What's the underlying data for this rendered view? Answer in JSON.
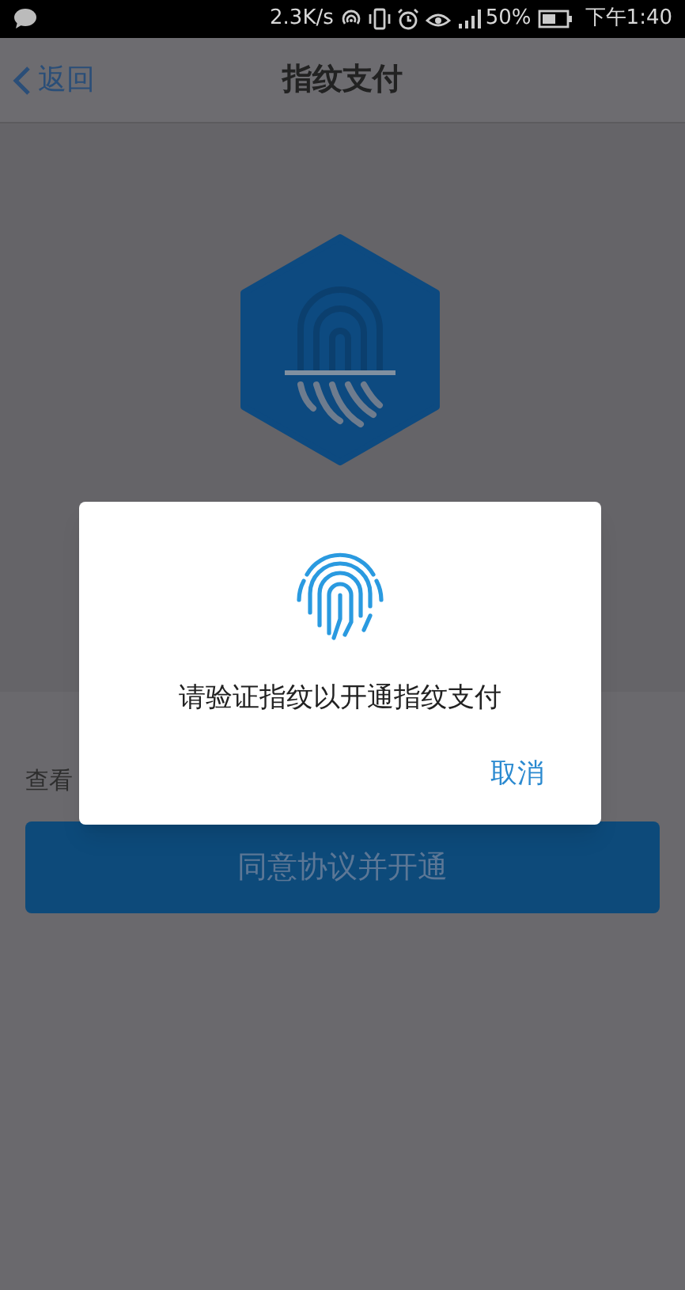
{
  "status_bar": {
    "speed": "2.3K/s",
    "battery": "50%",
    "time": "下午1:40"
  },
  "nav": {
    "back": "返回",
    "title": "指纹支付"
  },
  "page": {
    "agreement_fragment": "查看",
    "button": "同意协议并开通"
  },
  "dialog": {
    "message": "请验证指纹以开通指纹支付",
    "cancel": "取消"
  }
}
